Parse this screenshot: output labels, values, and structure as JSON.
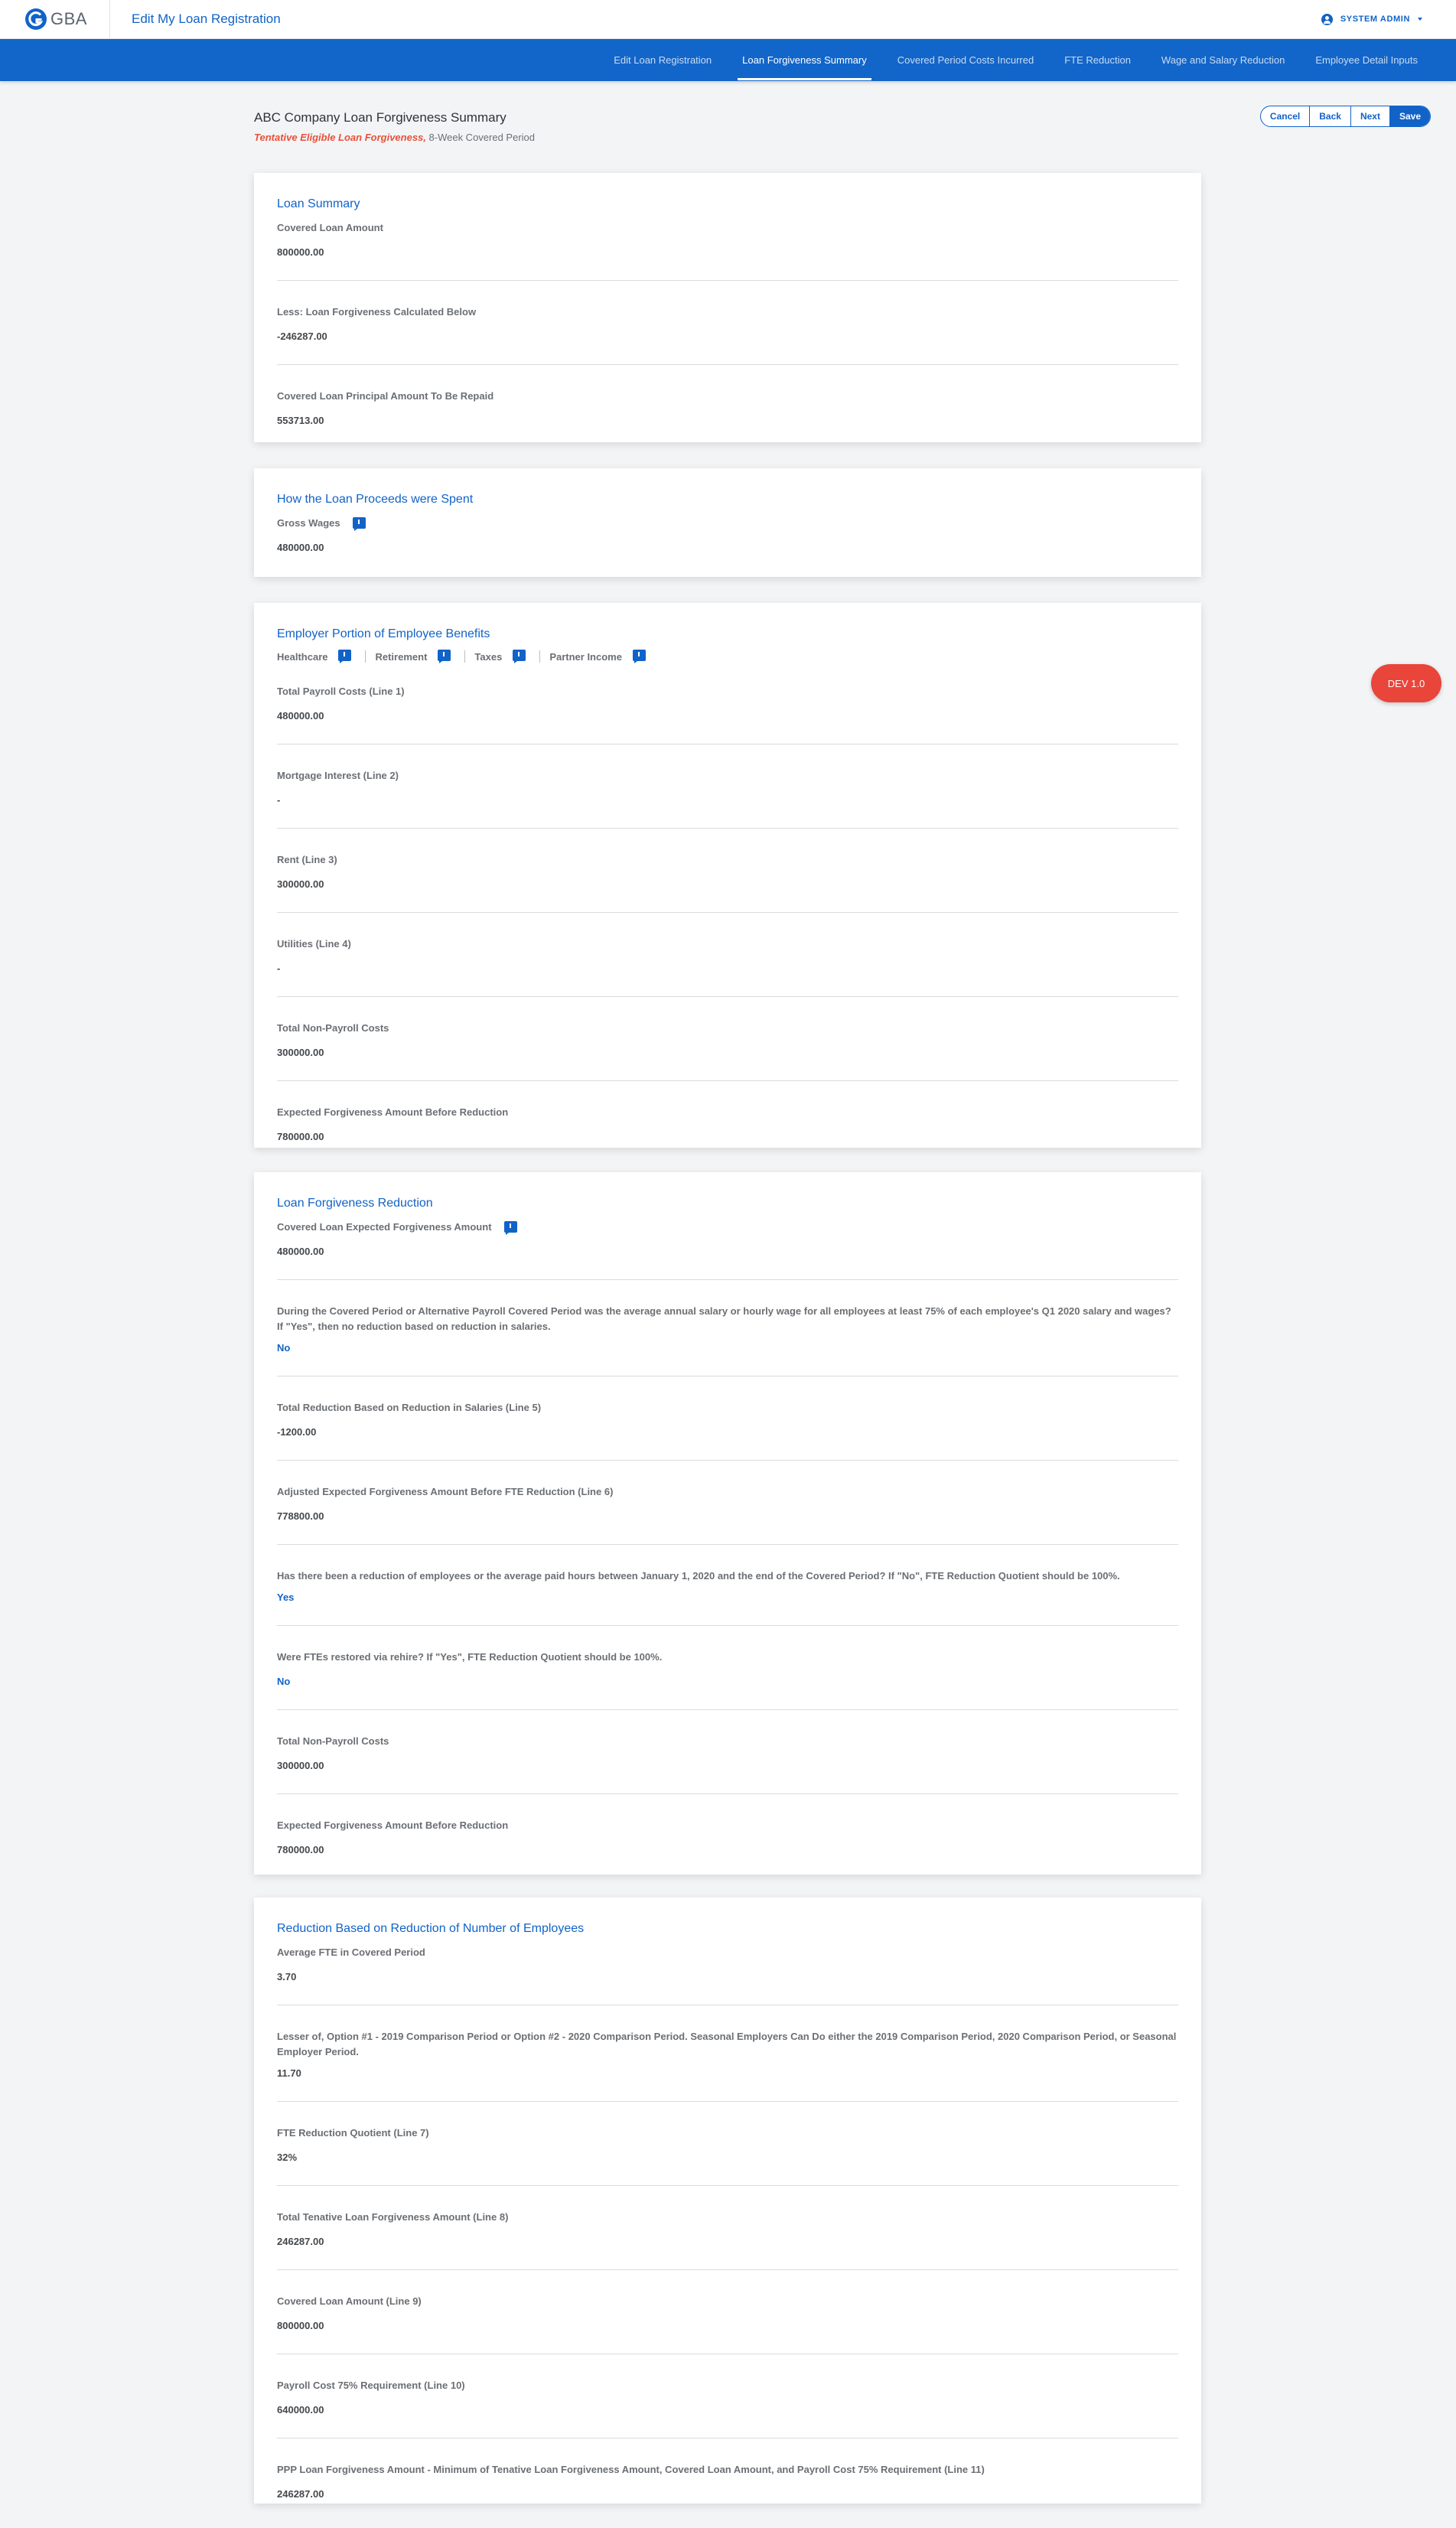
{
  "header": {
    "logo_text": "GBA",
    "title": "Edit My Loan Registration",
    "user": "SYSTEM ADMIN"
  },
  "tabs": [
    {
      "label": "Edit Loan Registration",
      "active": false
    },
    {
      "label": "Loan Forgiveness Summary",
      "active": true
    },
    {
      "label": "Covered Period Costs Incurred",
      "active": false
    },
    {
      "label": "FTE Reduction",
      "active": false
    },
    {
      "label": "Wage and Salary Reduction",
      "active": false
    },
    {
      "label": "Employee Detail Inputs",
      "active": false
    }
  ],
  "page": {
    "title": "ABC Company Loan Forgiveness Summary",
    "subtitle_highlight": "Tentative Eligible Loan Forgiveness,",
    "subtitle_rest": " 8-Week Covered Period",
    "actions": {
      "cancel": "Cancel",
      "back": "Back",
      "next": "Next",
      "save": "Save"
    }
  },
  "dev_badge": "DEV 1.0",
  "loan_summary": {
    "title": "Loan Summary",
    "fields": [
      {
        "label": "Covered Loan Amount",
        "value": "800000.00"
      },
      {
        "label": "Less: Loan Forgiveness Calculated Below",
        "value": "-246287.00"
      },
      {
        "label": "Covered Loan Principal Amount To Be Repaid",
        "value": "553713.00"
      }
    ]
  },
  "proceeds": {
    "title": "How the Loan Proceeds were Spent",
    "fields": [
      {
        "label": "Gross Wages",
        "value": "480000.00"
      }
    ]
  },
  "benefits": {
    "title": "Employer Portion of Employee Benefits",
    "items": [
      "Healthcare",
      "Retirement",
      "Taxes",
      "Partner Income"
    ],
    "fields": [
      {
        "label": "Total Payroll Costs (Line 1)",
        "value": "480000.00"
      },
      {
        "label": "Mortgage Interest (Line 2)",
        "value": "-"
      },
      {
        "label": "Rent (Line 3)",
        "value": "300000.00"
      },
      {
        "label": "Utilities (Line 4)",
        "value": "-"
      },
      {
        "label": "Total Non-Payroll Costs",
        "value": "300000.00"
      },
      {
        "label": "Expected Forgiveness Amount Before Reduction",
        "value": "780000.00"
      }
    ]
  },
  "reduction": {
    "title": "Loan Forgiveness Reduction",
    "fields": [
      {
        "label": "Covered Loan Expected Forgiveness Amount",
        "value": "480000.00"
      },
      {
        "label": "During the Covered Period or Alternative Payroll Covered Period was the average annual salary or hourly wage for all employees at least 75% of each employee's Q1 2020 salary and wages? If \"Yes\", then no reduction based on reduction in salaries.",
        "value": "No"
      },
      {
        "label": "Total Reduction Based on Reduction in Salaries (Line 5)",
        "value": "-1200.00"
      },
      {
        "label": "Adjusted Expected Forgiveness Amount Before FTE Reduction (Line 6)",
        "value": "778800.00"
      },
      {
        "label": "Has there been a reduction of employees or the average paid hours between January 1, 2020 and the end of the Covered Period? If \"No\", FTE Reduction Quotient should be 100%.",
        "value": "Yes"
      },
      {
        "label": "Were FTEs restored via rehire? If \"Yes\", FTE Reduction Quotient should be 100%.",
        "value": "No"
      },
      {
        "label": "Total Non-Payroll Costs",
        "value": "300000.00"
      },
      {
        "label": "Expected Forgiveness Amount Before Reduction",
        "value": "780000.00"
      }
    ]
  },
  "employees": {
    "title": "Reduction Based on Reduction of Number of Employees",
    "fields": [
      {
        "label": "Average FTE in Covered Period",
        "value": "3.70"
      },
      {
        "label": "Lesser of, Option #1 - 2019 Comparison Period or Option #2 - 2020 Comparison Period. Seasonal Employers Can Do either the 2019 Comparison Period, 2020 Comparison Period, or Seasonal Employer Period.",
        "value": "11.70"
      },
      {
        "label": "FTE Reduction Quotient (Line 7)",
        "value": "32%"
      },
      {
        "label": "Total Tenative Loan Forgiveness Amount (Line 8)",
        "value": "246287.00"
      },
      {
        "label": "Covered Loan Amount (Line 9)",
        "value": "800000.00"
      },
      {
        "label": "Payroll Cost 75% Requirement (Line 10)",
        "value": "640000.00"
      },
      {
        "label": "PPP Loan Forgiveness Amount - Minimum of Tenative Loan Forgiveness Amount, Covered Loan Amount, and Payroll Cost 75% Requirement (Line 11)",
        "value": "246287.00"
      }
    ]
  }
}
